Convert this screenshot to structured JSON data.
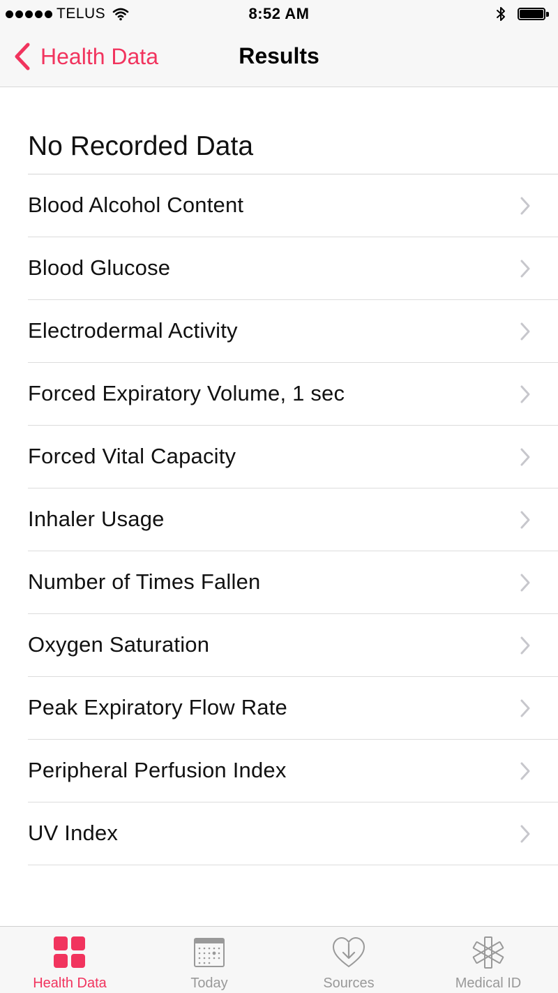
{
  "status_bar": {
    "carrier": "TELUS",
    "time": "8:52 AM",
    "icons": [
      "signal-dots-icon",
      "wifi-icon",
      "bluetooth-icon",
      "battery-icon"
    ]
  },
  "nav": {
    "back_label": "Health Data",
    "title": "Results"
  },
  "section": {
    "header": "No Recorded Data"
  },
  "items": [
    {
      "label": "Blood Alcohol Content"
    },
    {
      "label": "Blood Glucose"
    },
    {
      "label": "Electrodermal Activity"
    },
    {
      "label": "Forced Expiratory Volume, 1 sec"
    },
    {
      "label": "Forced Vital Capacity"
    },
    {
      "label": "Inhaler Usage"
    },
    {
      "label": "Number of Times Fallen"
    },
    {
      "label": "Oxygen Saturation"
    },
    {
      "label": "Peak Expiratory Flow Rate"
    },
    {
      "label": "Peripheral Perfusion Index"
    },
    {
      "label": "UV Index"
    }
  ],
  "tabs": [
    {
      "label": "Health Data",
      "icon": "grid-icon",
      "active": true
    },
    {
      "label": "Today",
      "icon": "calendar-icon",
      "active": false
    },
    {
      "label": "Sources",
      "icon": "heart-download-icon",
      "active": false
    },
    {
      "label": "Medical ID",
      "icon": "medical-asterisk-icon",
      "active": false
    }
  ],
  "colors": {
    "accent": "#f1345e",
    "inactive": "#999999",
    "bar_background": "#f7f7f7"
  }
}
